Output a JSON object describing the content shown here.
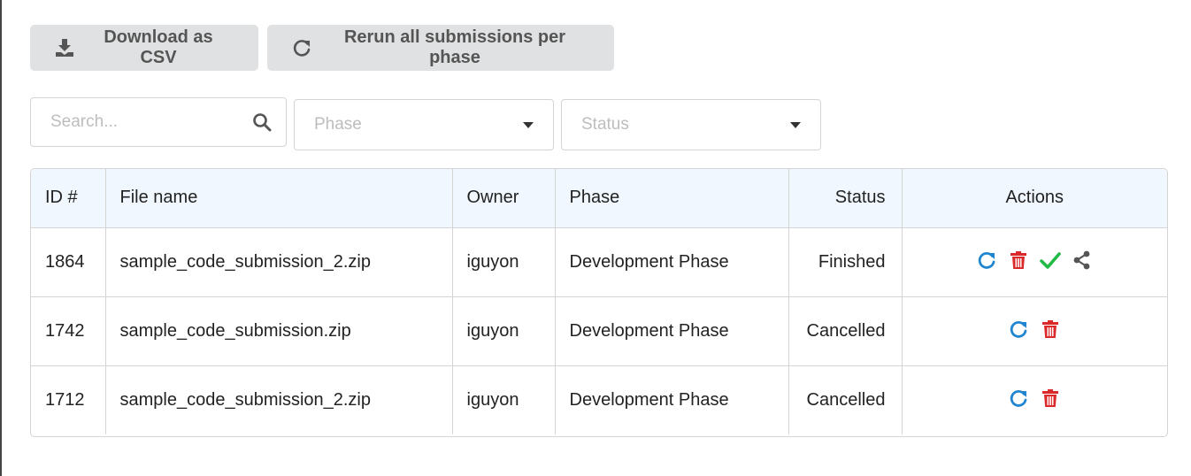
{
  "toolbar": {
    "download_label": "Download as CSV",
    "rerun_label": "Rerun all submissions per phase"
  },
  "filters": {
    "search_placeholder": "Search...",
    "phase_placeholder": "Phase",
    "status_placeholder": "Status"
  },
  "table": {
    "headers": {
      "id": "ID #",
      "file_name": "File name",
      "owner": "Owner",
      "phase": "Phase",
      "status": "Status",
      "actions": "Actions"
    },
    "rows": [
      {
        "id": "1864",
        "file_name": "sample_code_submission_2.zip",
        "owner": "iguyon",
        "phase": "Development Phase",
        "status": "Finished",
        "actions": [
          "rerun-icon",
          "delete-icon",
          "check-icon",
          "share-icon"
        ]
      },
      {
        "id": "1742",
        "file_name": "sample_code_submission.zip",
        "owner": "iguyon",
        "phase": "Development Phase",
        "status": "Cancelled",
        "actions": [
          "rerun-icon",
          "delete-icon"
        ]
      },
      {
        "id": "1712",
        "file_name": "sample_code_submission_2.zip",
        "owner": "iguyon",
        "phase": "Development Phase",
        "status": "Cancelled",
        "actions": [
          "rerun-icon",
          "delete-icon"
        ]
      }
    ]
  },
  "colors": {
    "rerun": "#2185d0",
    "delete": "#db2828",
    "check": "#21ba45",
    "share": "#555555",
    "header_bg": "#f0f7fe",
    "button_bg": "#e0e1e2"
  }
}
